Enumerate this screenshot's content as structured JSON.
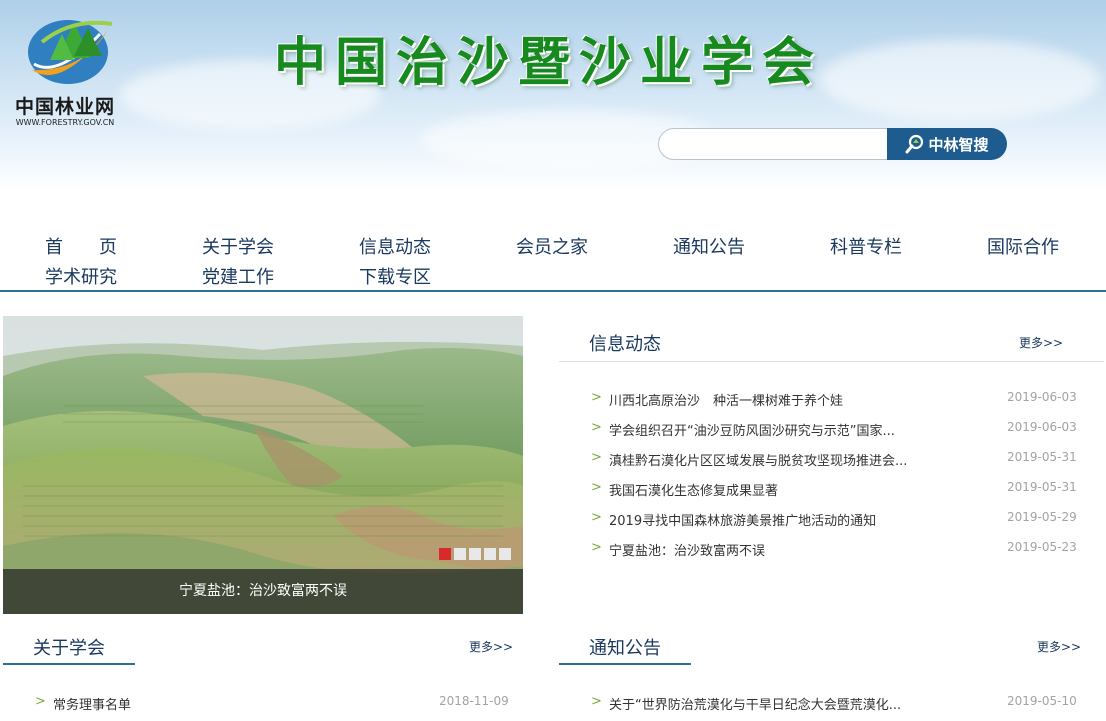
{
  "header": {
    "logo_cn": "中国林业网",
    "logo_en": "WWW.FORESTRY.GOV.CN",
    "site_title": "中国治沙暨沙业学会",
    "search_placeholder": "",
    "search_button": "中林智搜"
  },
  "nav": [
    {
      "label": "首　　页"
    },
    {
      "label": "关于学会"
    },
    {
      "label": "信息动态"
    },
    {
      "label": "会员之家"
    },
    {
      "label": "通知公告"
    },
    {
      "label": "科普专栏"
    },
    {
      "label": "国际合作"
    },
    {
      "label": "学术研究"
    },
    {
      "label": "党建工作"
    },
    {
      "label": "下载专区"
    }
  ],
  "slider": {
    "caption": "宁夏盐池：治沙致富两不误",
    "slide_count": 5,
    "active_slide": 1
  },
  "news": {
    "title": "信息动态",
    "more": "更多>>",
    "items": [
      {
        "title": "川西北高原治沙　种活一棵树难于养个娃",
        "date": "2019-06-03"
      },
      {
        "title": "学会组织召开“油沙豆防风固沙研究与示范”国家...",
        "date": "2019-06-03"
      },
      {
        "title": "滇桂黔石漠化片区区域发展与脱贫攻坚现场推进会...",
        "date": "2019-05-31"
      },
      {
        "title": "我国石漠化生态修复成果显著",
        "date": "2019-05-31"
      },
      {
        "title": "2019寻找中国森林旅游美景推广地活动的通知",
        "date": "2019-05-29"
      },
      {
        "title": "宁夏盐池：治沙致富两不误",
        "date": "2019-05-23"
      }
    ]
  },
  "about": {
    "title": "关于学会",
    "more": "更多>>",
    "items": [
      {
        "title": "常务理事名单",
        "date": "2018-11-09"
      }
    ]
  },
  "notice": {
    "title": "通知公告",
    "more": "更多>>",
    "items": [
      {
        "title": "关于“世界防治荒漠化与干旱日纪念大会暨荒漠化...",
        "date": "2019-05-10"
      }
    ]
  },
  "colors": {
    "title_green": "#178a1f",
    "nav_text": "#1b3a60",
    "accent_blue": "#2b6f93",
    "search_button": "#1e5b8f",
    "active_dot": "#d72a2a",
    "arrow_green": "#7aa93a",
    "date_gray": "#a3a3a3"
  }
}
